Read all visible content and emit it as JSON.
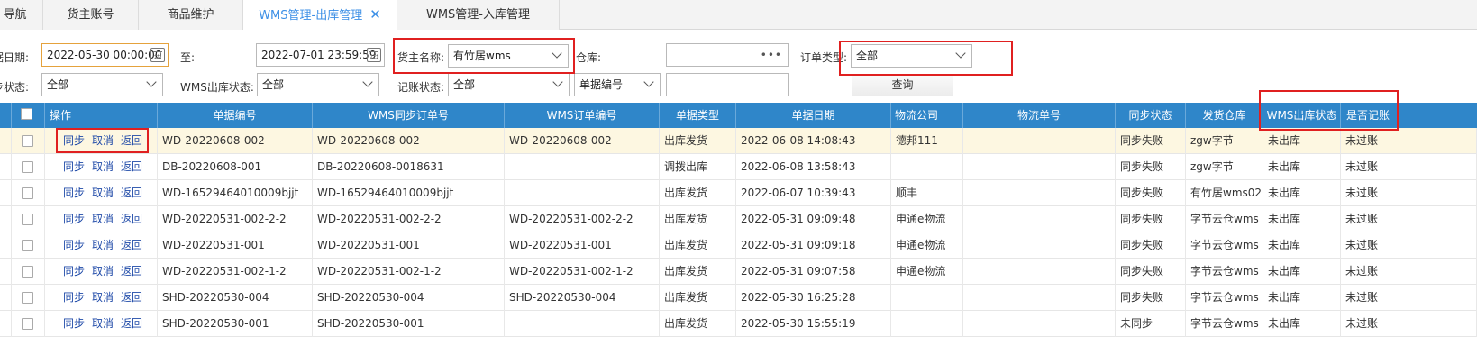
{
  "tabs": [
    {
      "label": "导航",
      "active": false
    },
    {
      "label": "货主账号",
      "active": false
    },
    {
      "label": "商品维护",
      "active": false
    },
    {
      "label": "WMS管理-出库管理",
      "active": true,
      "close": "✕"
    },
    {
      "label": "WMS管理-入库管理",
      "active": false
    }
  ],
  "filters": {
    "date_label": "单据日期:",
    "date_from": "2022-05-30 00:00:00",
    "to_label": "至:",
    "date_to": "2022-07-01 23:59:59",
    "owner_label": "货主名称:",
    "owner_value": "有竹居wms",
    "warehouse_label": "仓库:",
    "warehouse_value": "",
    "warehouse_more": "•••",
    "order_type_label": "订单类型:",
    "order_type_value": "全部",
    "sync_status_label": "同步状态:",
    "sync_status_value": "全部",
    "wms_status_label": "WMS出库状态:",
    "wms_status_value": "全部",
    "account_status_label": "记账状态:",
    "account_status_value": "全部",
    "field_select_value": "单据编号",
    "field_input_value": "",
    "query_button": "查询"
  },
  "columns": [
    "操作",
    "单据编号",
    "WMS同步订单号",
    "WMS订单编号",
    "单据类型",
    "单据日期",
    "物流公司",
    "物流单号",
    "同步状态",
    "发货仓库",
    "WMS出库状态",
    "是否记账"
  ],
  "actions": {
    "sync": "同步",
    "cancel": "取消",
    "back": "返回"
  },
  "rows": [
    {
      "doc_no": "WD-20220608-002",
      "wms_sync_no": "WD-20220608-002",
      "wms_order_no": "WD-20220608-002",
      "type": "出库发货",
      "date": "2022-06-08 14:08:43",
      "logistics": "德邦111",
      "tracking": "",
      "sync": "同步失败",
      "warehouse": "zgw字节",
      "wms_status": "未出库",
      "accounted": "未过账"
    },
    {
      "doc_no": "DB-20220608-001",
      "wms_sync_no": "DB-20220608-0018631",
      "wms_order_no": "",
      "type": "调拨出库",
      "date": "2022-06-08 13:58:43",
      "logistics": "",
      "tracking": "",
      "sync": "同步失败",
      "warehouse": "zgw字节",
      "wms_status": "未出库",
      "accounted": "未过账"
    },
    {
      "doc_no": "WD-16529464010009bjjt",
      "wms_sync_no": "WD-16529464010009bjjt",
      "wms_order_no": "",
      "type": "出库发货",
      "date": "2022-06-07 10:39:43",
      "logistics": "顺丰",
      "tracking": "",
      "sync": "同步失败",
      "warehouse": "有竹居wms02",
      "wms_status": "未出库",
      "accounted": "未过账"
    },
    {
      "doc_no": "WD-20220531-002-2-2",
      "wms_sync_no": "WD-20220531-002-2-2",
      "wms_order_no": "WD-20220531-002-2-2",
      "type": "出库发货",
      "date": "2022-05-31 09:09:48",
      "logistics": "申通e物流",
      "tracking": "",
      "sync": "同步失败",
      "warehouse": "字节云仓wms",
      "wms_status": "未出库",
      "accounted": "未过账"
    },
    {
      "doc_no": "WD-20220531-001",
      "wms_sync_no": "WD-20220531-001",
      "wms_order_no": "WD-20220531-001",
      "type": "出库发货",
      "date": "2022-05-31 09:09:18",
      "logistics": "申通e物流",
      "tracking": "",
      "sync": "同步失败",
      "warehouse": "字节云仓wms",
      "wms_status": "未出库",
      "accounted": "未过账"
    },
    {
      "doc_no": "WD-20220531-002-1-2",
      "wms_sync_no": "WD-20220531-002-1-2",
      "wms_order_no": "WD-20220531-002-1-2",
      "type": "出库发货",
      "date": "2022-05-31 09:07:58",
      "logistics": "申通e物流",
      "tracking": "",
      "sync": "同步失败",
      "warehouse": "字节云仓wms",
      "wms_status": "未出库",
      "accounted": "未过账"
    },
    {
      "doc_no": "SHD-20220530-004",
      "wms_sync_no": "SHD-20220530-004",
      "wms_order_no": "SHD-20220530-004",
      "type": "出库发货",
      "date": "2022-05-30 16:25:28",
      "logistics": "",
      "tracking": "",
      "sync": "同步失败",
      "warehouse": "字节云仓wms",
      "wms_status": "未出库",
      "accounted": "未过账"
    },
    {
      "doc_no": "SHD-20220530-001",
      "wms_sync_no": "SHD-20220530-001",
      "wms_order_no": "",
      "type": "出库发货",
      "date": "2022-05-30 15:55:19",
      "logistics": "",
      "tracking": "",
      "sync": "未同步",
      "warehouse": "字节云仓wms",
      "wms_status": "未出库",
      "accounted": "未过账"
    }
  ],
  "colors": {
    "header_bg": "#2f86c9",
    "active_tab": "#3a8ee6",
    "highlight_box": "#e02020",
    "selected_row": "#fdf7e1",
    "action_link": "#1f4aa8"
  }
}
